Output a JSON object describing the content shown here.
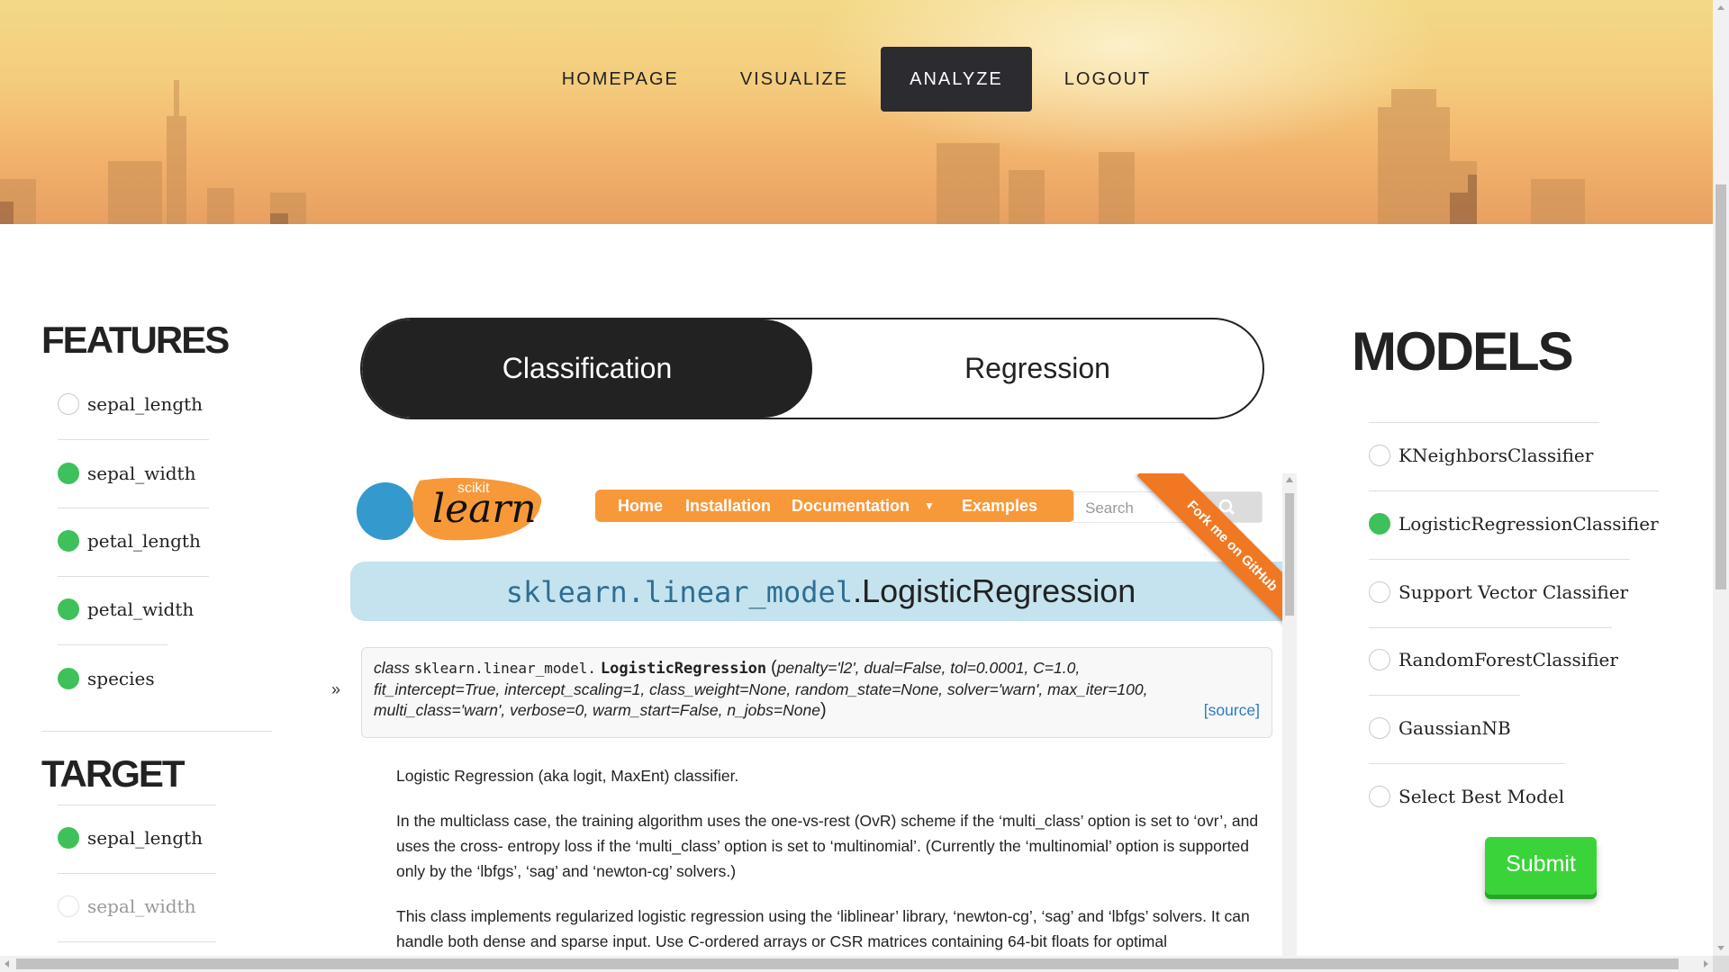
{
  "nav": {
    "items": [
      {
        "label": "HOMEPAGE",
        "active": false
      },
      {
        "label": "VISUALIZE",
        "active": false
      },
      {
        "label": "ANALYZE",
        "active": true
      },
      {
        "label": "LOGOUT",
        "active": false
      }
    ]
  },
  "features": {
    "heading": "FEATURES",
    "items": [
      {
        "label": "sepal_length",
        "selected": false
      },
      {
        "label": "sepal_width",
        "selected": true
      },
      {
        "label": "petal_length",
        "selected": true
      },
      {
        "label": "petal_width",
        "selected": true
      },
      {
        "label": "species",
        "selected": true
      }
    ]
  },
  "target": {
    "heading": "TARGET",
    "items": [
      {
        "label": "sepal_length",
        "selected": true,
        "disabled": false
      },
      {
        "label": "sepal_width",
        "selected": false,
        "disabled": true
      }
    ]
  },
  "mode_toggle": {
    "options": [
      "Classification",
      "Regression"
    ],
    "active": "Classification"
  },
  "doc": {
    "logo": {
      "small": "scikit",
      "big": "learn"
    },
    "nav": [
      "Home",
      "Installation",
      "Documentation",
      "Examples"
    ],
    "search_placeholder": "Search",
    "ribbon": "Fork me on GitHub",
    "title_module": "sklearn.linear_model",
    "title_class": ".LogisticRegression",
    "signature": {
      "prefix": "class",
      "module": "sklearn.linear_model.",
      "classname": "LogisticRegression",
      "params_line1": "penalty='l2', dual=False, tol=0.0001, C=1.0,",
      "params_line2": "fit_intercept=True, intercept_scaling=1, class_weight=None, random_state=None, solver='warn', max_iter=100,",
      "params_line3": "multi_class='warn', verbose=0, warm_start=False, n_jobs=None",
      "source_link": "[source]"
    },
    "sidebar_toggle": "»",
    "paragraphs": [
      "Logistic Regression (aka logit, MaxEnt) classifier.",
      "In the multiclass case, the training algorithm uses the one-vs-rest (OvR) scheme if the ‘multi_class’ option is set to ‘ovr’, and uses the cross- entropy loss if the ‘multi_class’ option is set to ‘multinomial’. (Currently the ‘multinomial’ option is supported only by the ‘lbfgs’, ‘sag’ and ‘newton-cg’ solvers.)",
      "This class implements regularized logistic regression using the ‘liblinear’ library, ‘newton-cg’, ‘sag’ and ‘lbfgs’ solvers. It can handle both dense and sparse input. Use C-ordered arrays or CSR matrices containing 64-bit floats for optimal"
    ]
  },
  "models": {
    "heading": "MODELS",
    "items": [
      {
        "label": "KNeighborsClassifier",
        "selected": false
      },
      {
        "label": "LogisticRegressionClassifier",
        "selected": true
      },
      {
        "label": "Support Vector Classifier",
        "selected": false
      },
      {
        "label": "RandomForestClassifier",
        "selected": false
      },
      {
        "label": "GaussianNB",
        "selected": false
      },
      {
        "label": "Select Best Model",
        "selected": false
      }
    ],
    "submit_label": "Submit"
  },
  "colors": {
    "accent_selected": "#3ec15a",
    "nav_active": "#2b2b30",
    "sklearn_orange": "#f89939",
    "submit_green": "#3ad43a"
  }
}
